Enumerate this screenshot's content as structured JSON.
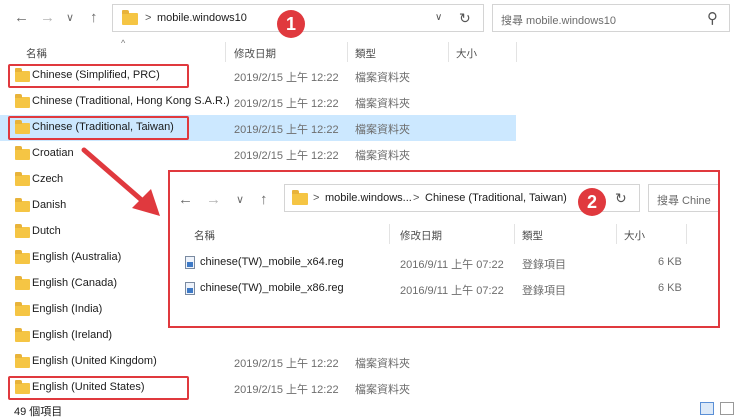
{
  "toolbar": {
    "back": "←",
    "forward": "→",
    "recent": "∨",
    "up": "↑",
    "address_path": "mobile.windows10",
    "chevron": ">",
    "dropdown": "∨",
    "refresh": "↻",
    "search_placeholder": "搜尋 mobile.windows10",
    "search_icon": "⚲"
  },
  "columns": {
    "name": "名稱",
    "date": "修改日期",
    "type": "類型",
    "size": "大小"
  },
  "rows": [
    {
      "name": "Chinese (Simplified, PRC)",
      "date": "2019/2/15 上午 12:22",
      "type": "檔案資料夾"
    },
    {
      "name": "Chinese (Traditional, Hong Kong S.A.R.)",
      "date": "2019/2/15 上午 12:22",
      "type": "檔案資料夾"
    },
    {
      "name": "Chinese (Traditional, Taiwan)",
      "date": "2019/2/15 上午 12:22",
      "type": "檔案資料夾"
    },
    {
      "name": "Croatian",
      "date": "2019/2/15 上午 12:22",
      "type": "檔案資料夾"
    },
    {
      "name": "Czech",
      "date": "",
      "type": ""
    },
    {
      "name": "Danish",
      "date": "",
      "type": ""
    },
    {
      "name": "Dutch",
      "date": "",
      "type": ""
    },
    {
      "name": "English (Australia)",
      "date": "",
      "type": ""
    },
    {
      "name": "English (Canada)",
      "date": "",
      "type": ""
    },
    {
      "name": "English (India)",
      "date": "",
      "type": ""
    },
    {
      "name": "English (Ireland)",
      "date": "",
      "type": ""
    },
    {
      "name": "English (United Kingdom)",
      "date": "2019/2/15 上午 12:22",
      "type": "檔案資料夾"
    },
    {
      "name": "English (United States)",
      "date": "2019/2/15 上午 12:22",
      "type": "檔案資料夾"
    }
  ],
  "status": {
    "count": "49 個項目"
  },
  "badges": {
    "one": "1",
    "two": "2"
  },
  "inner": {
    "back": "←",
    "forward": "→",
    "recent": "∨",
    "up": "↑",
    "address_path_1": "mobile.windows...",
    "address_path_2": "Chinese (Traditional, Taiwan)",
    "chevron": ">",
    "dropdown": "∨",
    "refresh": "↻",
    "search_placeholder": "搜尋 Chine",
    "columns": {
      "name": "名稱",
      "date": "修改日期",
      "type": "類型",
      "size": "大小"
    },
    "files": [
      {
        "name": "chinese(TW)_mobile_x64.reg",
        "date": "2016/9/11 上午 07:22",
        "type": "登錄項目",
        "size": "6 KB"
      },
      {
        "name": "chinese(TW)_mobile_x86.reg",
        "date": "2016/9/11 上午 07:22",
        "type": "登錄項目",
        "size": "6 KB"
      }
    ]
  },
  "colors": {
    "annotation_red": "#e0393e",
    "selected_row": "#cce8ff",
    "folder": "#f5c544"
  }
}
